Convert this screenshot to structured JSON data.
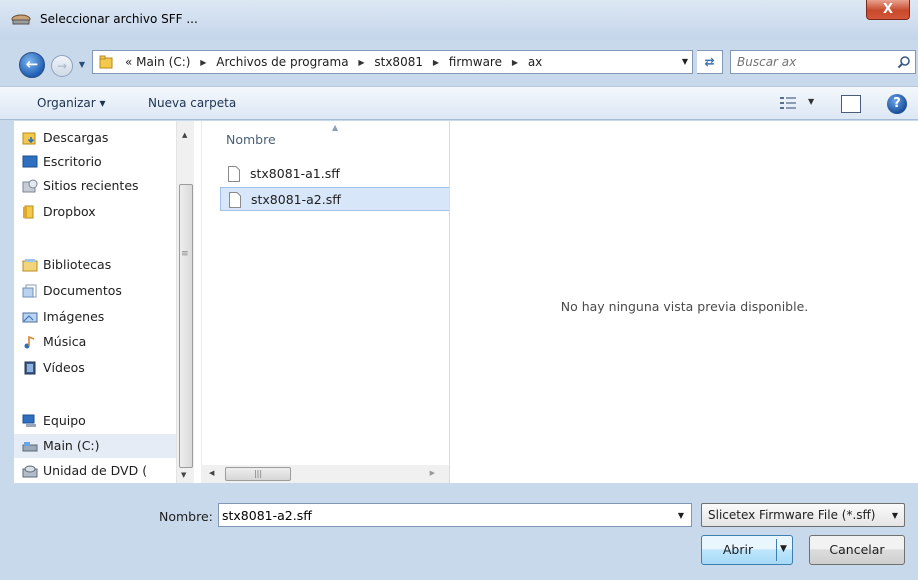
{
  "window": {
    "title": "Seleccionar archivo SFF ...",
    "close_glyph": "X"
  },
  "address": {
    "crumbs": [
      "«",
      "Main (C:)",
      "Archivos de programa",
      "stx8081",
      "firmware",
      "ax"
    ]
  },
  "search": {
    "placeholder": "Buscar ax"
  },
  "toolbar": {
    "organize_label": "Organizar ▾",
    "new_folder_label": "Nueva carpeta"
  },
  "nav_pane": {
    "items": [
      {
        "label": "Descargas",
        "icon": "downloads-folder-icon"
      },
      {
        "label": "Escritorio",
        "icon": "desktop-icon"
      },
      {
        "label": "Sitios recientes",
        "icon": "recent-places-icon"
      },
      {
        "label": "Dropbox",
        "icon": "folder-icon"
      },
      {
        "label": "Bibliotecas",
        "icon": "libraries-icon"
      },
      {
        "label": "Documentos",
        "icon": "documents-icon"
      },
      {
        "label": "Imágenes",
        "icon": "pictures-icon"
      },
      {
        "label": "Música",
        "icon": "music-icon"
      },
      {
        "label": "Vídeos",
        "icon": "videos-icon"
      },
      {
        "label": "Equipo",
        "icon": "computer-icon"
      },
      {
        "label": "Main (C:)",
        "icon": "drive-icon",
        "selected": true
      },
      {
        "label": "Unidad de DVD (",
        "icon": "dvd-drive-icon"
      }
    ]
  },
  "file_list": {
    "column_header": "Nombre",
    "files": [
      {
        "name": "stx8081-a1.sff",
        "selected": false
      },
      {
        "name": "stx8081-a2.sff",
        "selected": true
      }
    ]
  },
  "preview": {
    "message": "No hay ninguna vista previa disponible."
  },
  "footer": {
    "name_label": "Nombre:",
    "name_value": "stx8081-a2.sff",
    "file_type": "Slicetex Firmware File (*.sff)",
    "open_label": "Abrir",
    "cancel_label": "Cancelar"
  },
  "colors": {
    "frame": "#c9d9ec",
    "selection": "#d8e6f9",
    "close_button": "#c74a2c"
  }
}
